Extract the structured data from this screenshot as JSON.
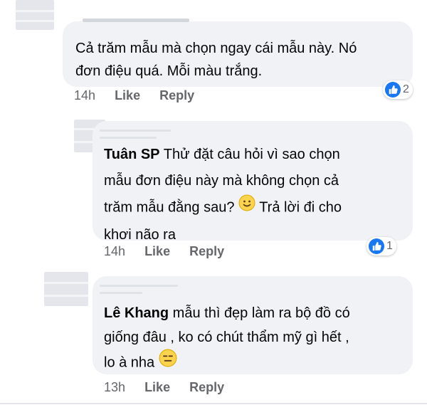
{
  "comments": [
    {
      "author": "",
      "lines": [
        "Cả trăm mẫu mà chọn ngay cái mẫu này. Nó",
        "đơn điệu quá. Mỗi màu trắng."
      ],
      "time": "14h",
      "like": "Like",
      "reply": "Reply",
      "reactions": "2"
    },
    {
      "author": "Tuân SP",
      "line1_rest": " Thử đặt câu hỏi vì sao chọn",
      "line2": "mẫu đơn điệu này mà không chọn cả",
      "line3_before": "trăm mẫu đằng sau? ",
      "line3_after": " Trả lời đi cho",
      "line4": "khơi não ra",
      "time": "14h",
      "like": "Like",
      "reply": "Reply",
      "reactions": "1"
    },
    {
      "author": "Lê Khang",
      "line1_rest": " mẫu thì đẹp làm ra bộ đồ có",
      "line2": "giống đâu , ko có chút thẩm mỹ gì hết ,",
      "line3_before": "lo à nha ",
      "time": "13h",
      "like": "Like",
      "reply": "Reply"
    }
  ],
  "colors": {
    "bubble": "#f0f2f5",
    "like_blue": "#1877f2",
    "meta_gray": "#65676b"
  }
}
